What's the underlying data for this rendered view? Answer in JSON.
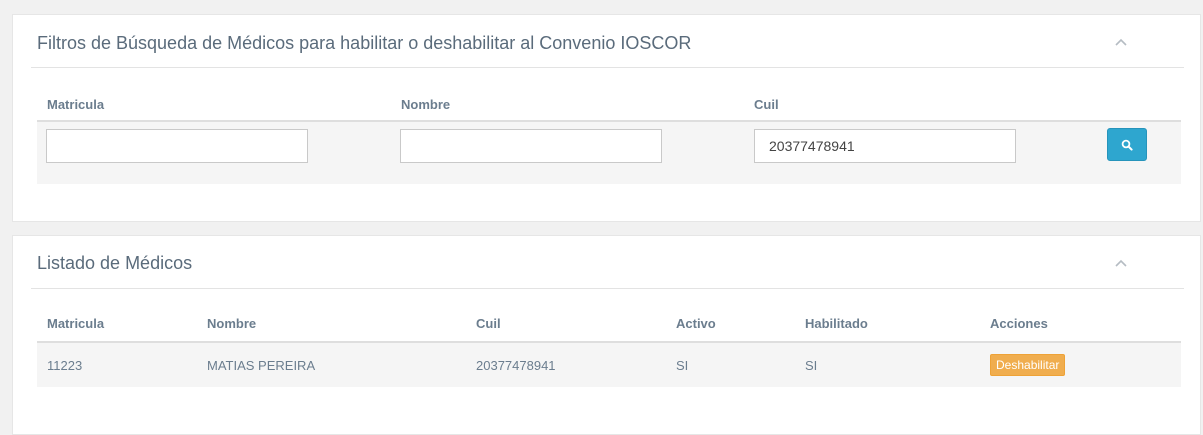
{
  "filters_panel": {
    "title": "Filtros de Búsqueda de Médicos para habilitar o deshabilitar al Convenio IOSCOR",
    "collapse_icon": "chevron-up-icon",
    "fields": [
      {
        "label": "Matricula",
        "value": "",
        "placeholder": ""
      },
      {
        "label": "Nombre",
        "value": "",
        "placeholder": ""
      },
      {
        "label": "Cuil",
        "value": "20377478941",
        "placeholder": ""
      }
    ],
    "search_icon": "search-icon",
    "search_button_color": "#2ea6cf"
  },
  "list_panel": {
    "title": "Listado de Médicos",
    "collapse_icon": "chevron-up-icon",
    "columns": [
      "Matricula",
      "Nombre",
      "Cuil",
      "Activo",
      "Habilitado",
      "Acciones"
    ],
    "rows": [
      {
        "matricula": "11223",
        "nombre": "MATIAS PEREIRA",
        "cuil": "20377478941",
        "activo": "SI",
        "habilitado": "SI",
        "action_label": "Deshabilitar"
      }
    ],
    "action_button_color": "#f0ad4e"
  }
}
